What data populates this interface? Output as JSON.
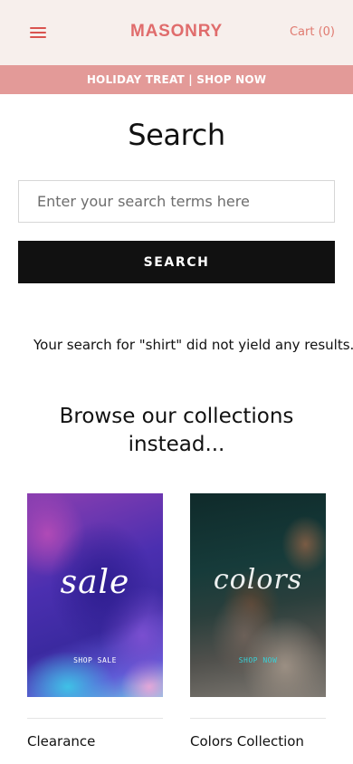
{
  "header": {
    "logo": "MASONRY",
    "cart_label": "Cart (0)",
    "menu_icon": "hamburger-menu-icon"
  },
  "promo_bar": {
    "text": "HOLIDAY TREAT | SHOP NOW"
  },
  "main": {
    "title": "Search",
    "search": {
      "placeholder": "Enter your search terms here",
      "value": "",
      "button_label": "SEARCH"
    },
    "no_results": "Your search for \"shirt\" did not yield any results.",
    "browse_title_line1": "Browse our collections",
    "browse_title_line2": "instead..."
  },
  "collections": [
    {
      "image_text": "sale",
      "image_cta": "SHOP SALE",
      "label": "Clearance"
    },
    {
      "image_text": "colors",
      "image_cta": "SHOP NOW",
      "label": "Colors Collection"
    }
  ],
  "colors": {
    "brand": "#e06c6c",
    "header_bg": "#f7efec",
    "promo_bg": "#e39a98",
    "button_bg": "#111111"
  }
}
